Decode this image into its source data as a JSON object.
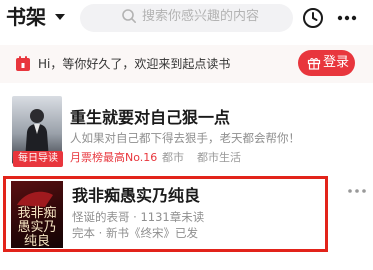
{
  "header": {
    "title": "书架",
    "search_placeholder": "搜索你感兴趣的内容"
  },
  "banner": {
    "text": "Hi，等你好久了，欢迎来到起点读书",
    "login_label": "登录"
  },
  "books": [
    {
      "title": "重生就要对自己狠一点",
      "description": "人如果对自己都下得去狠手，老天都会帮你！",
      "badge": "每日导读",
      "rank": "月票榜最高No.16",
      "category": "都市",
      "subcategory": "都市生活"
    },
    {
      "title": "我非痴愚实乃纯良",
      "author_info": "怪诞的表哥 · 1131章未读",
      "status": "完本 · 新书《终宋》已发",
      "cover_text": "我非痴愚实乃纯良"
    }
  ],
  "colors": {
    "accent": "#e8363d",
    "highlight_border": "#e2231a"
  }
}
